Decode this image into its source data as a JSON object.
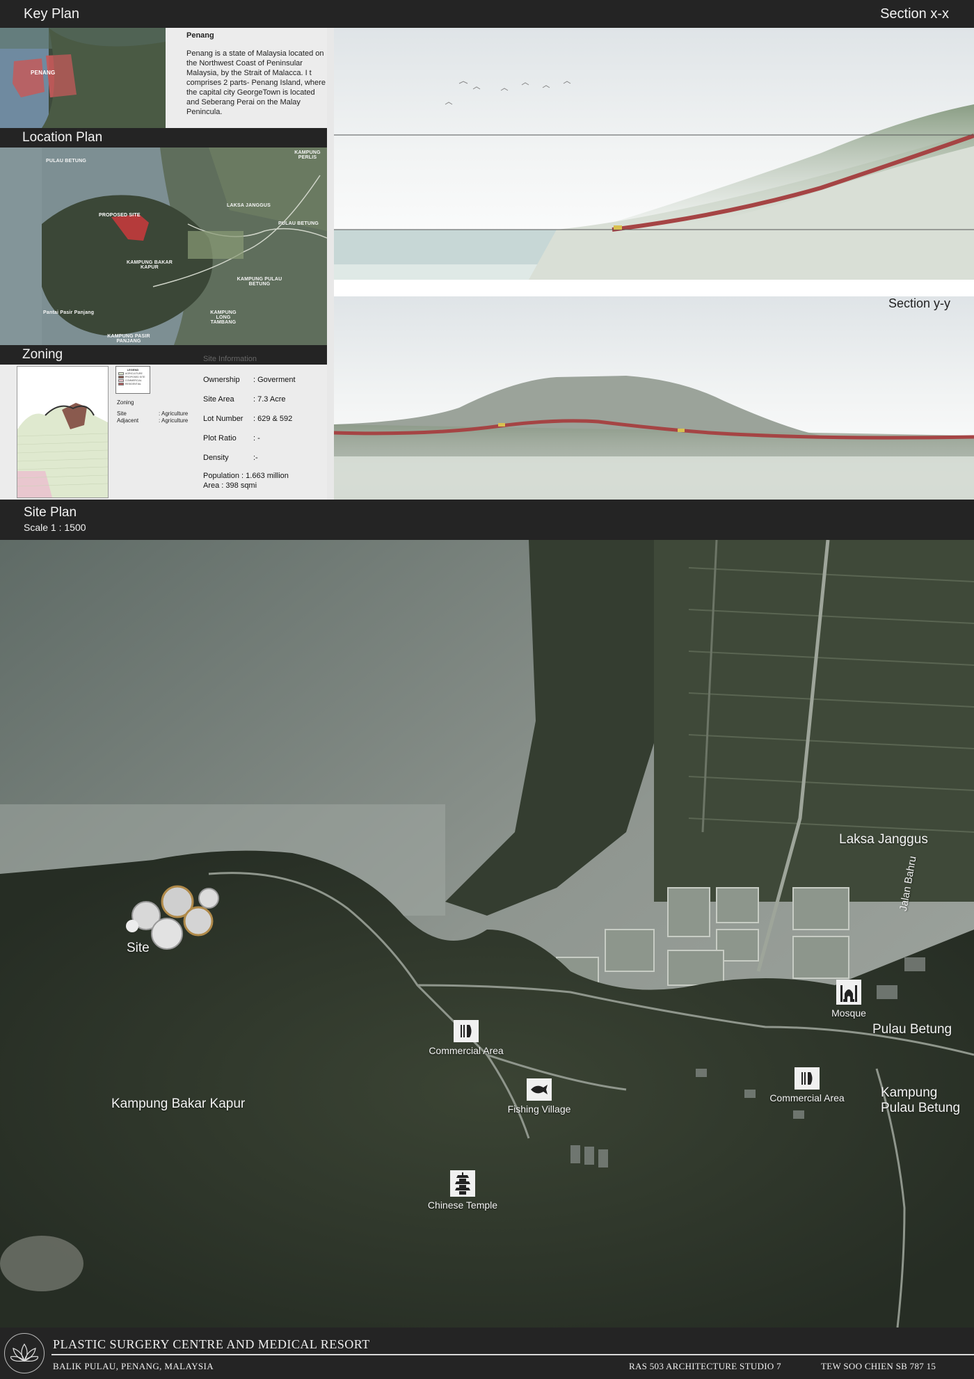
{
  "key_plan": {
    "title": "Key  Plan",
    "map_label": "PENANG",
    "heading": "Penang",
    "description": "Penang is a state of Malaysia located on the Northwest Coast of Peninsular Malaysia, by the Strait of Malacca. I t comprises 2 parts- Penang Island, where the capital city GeorgeTown is located and Seberang Perai on the Malay Penincula."
  },
  "location_plan": {
    "title": "Location Plan",
    "labels": {
      "pulau_betung_top": "PULAU BETUNG",
      "kampung_perlis": "KAMPUNG PERLIS",
      "laksa_janggus": "LAKSA JANGGUS",
      "proposed_site": "PROPOSED SITE",
      "pulau_betung": "PULAU BETUNG",
      "kampung_bakar_kapur": "KAMPUNG BAKAR KAPUR",
      "kampung_pulau_betung": "KAMPUNG PULAU BETUNG",
      "pantai_pasir_panjang": "Pantai Pasir Panjang",
      "kampung_long_tambang": "KAMPUNG LONG TAMBANG",
      "kampung_pasir_panjang": "KAMPUNG PASIR PANJANG"
    }
  },
  "zoning": {
    "title": "Zoning",
    "legend_title": "LEGEND",
    "legend_items": [
      "AGRICULTURE",
      "PROPOSED SITE",
      "COMMERCIAL",
      "RESIDENTIAL"
    ],
    "legend_colors": [
      "#dfe9cf",
      "#8a5a4e",
      "#e9c7cf",
      "#b05a5a"
    ],
    "zoning_label": "Zoning",
    "site_label": "Site",
    "site_value": ": Agriculture",
    "adjacent_label": "Adjacent",
    "adjacent_value": ": Agriculture"
  },
  "site_information": {
    "title": "Site Information",
    "rows": [
      {
        "label": "Ownership",
        "value": ": Goverment"
      },
      {
        "label": "Site Area",
        "value": ": 7.3 Acre"
      },
      {
        "label": "Lot Number",
        "value": ":  629 &  592"
      },
      {
        "label": "Plot Ratio",
        "value": ": -"
      },
      {
        "label": "Density",
        "value": ":-"
      }
    ],
    "population": "Population : 1.663 million",
    "area": "Area : 398 sqmi"
  },
  "sections": {
    "xx_title": "Section x-x",
    "yy_title": "Section y-y"
  },
  "site_plan": {
    "title": "Site Plan",
    "scale": "Scale 1 : 1500",
    "labels": {
      "site": "Site",
      "kampung_bakar_kapur": "Kampung Bakar Kapur",
      "laksa_janggus": "Laksa Janggus",
      "jalan_bahru": "Jalan Bahru",
      "pulau_betung": "Pulau Betung",
      "kampung_pulau_betung_1": "Kampung",
      "kampung_pulau_betung_2": "Pulau Betung"
    },
    "pois": {
      "commercial_1": "Commercial Area",
      "fishing_village": "Fishing Village",
      "chinese_temple": "Chinese Temple",
      "mosque": "Mosque",
      "commercial_2": "Commercial Area"
    }
  },
  "footer": {
    "project_title": "PLASTIC SURGERY CENTRE AND MEDICAL RESORT",
    "location": "BALIK PULAU, PENANG, MALAYSIA",
    "course": "RAS 503 ARCHITECTURE STUDIO 7",
    "author": "TEW SOO CHIEN SB 787 15"
  }
}
